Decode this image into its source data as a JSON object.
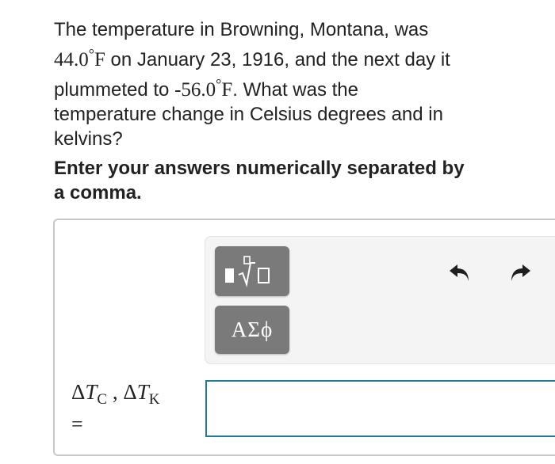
{
  "question": {
    "part1": "The temperature in Browning, Montana, was ",
    "t1_value": "44.0",
    "t1_unit": "F",
    "part2": " on January 23, 1916, and the next day it plummeted to ",
    "t2_value": "-56.0",
    "t2_unit": "F",
    "part3": ". What was the temperature change in Celsius degrees and in kelvins?",
    "degree_symbol": "°"
  },
  "instruction": "Enter your answers numerically separated by a comma.",
  "toolbar": {
    "templates_icon": "fraction-radical-template-icon",
    "symbols_label": "ΑΣϕ",
    "undo_icon": "undo-icon",
    "redo_icon": "redo-icon",
    "button_color": "#7a7a7a"
  },
  "answer": {
    "delta": "Δ",
    "var": "T",
    "sub_c": "C",
    "sub_k": "K",
    "separator": " , ",
    "equals": "=",
    "value": "",
    "border_color": "#1f7a95"
  }
}
